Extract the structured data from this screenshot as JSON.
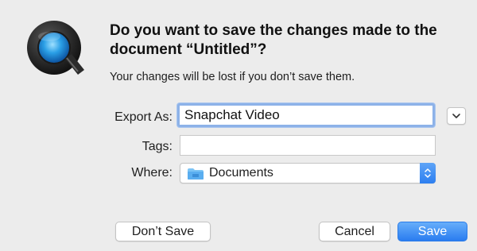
{
  "app_icon": "quicktime-icon",
  "dialog": {
    "title": "Do you want to save the changes made to the document “Untitled”?",
    "message": "Your changes will be lost if you don’t save them."
  },
  "form": {
    "export_as_label": "Export As:",
    "export_as_value": "Snapchat Video",
    "tags_label": "Tags:",
    "tags_value": "",
    "where_label": "Where:",
    "where_value": "Documents",
    "where_icon": "folder-icon"
  },
  "buttons": {
    "dont_save": "Don’t Save",
    "cancel": "Cancel",
    "save": "Save"
  },
  "colors": {
    "accent": "#2a7cf0",
    "focus_ring": "#8db2e8",
    "background": "#ececec"
  }
}
